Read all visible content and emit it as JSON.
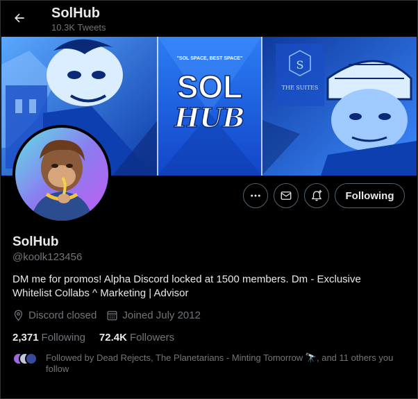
{
  "header": {
    "title": "SolHub",
    "tweets_count": "10.3K Tweets"
  },
  "banner": {
    "tagline": "\"SOL SPACE, BEST SPACE\"",
    "logo_line1": "SOL",
    "logo_line2": "HUB",
    "suites_monogram": "S",
    "suites_label": "THE SUITES"
  },
  "actions": {
    "follow_label": "Following"
  },
  "profile": {
    "name": "SolHub",
    "handle": "@koolk123456",
    "bio": "DM me for promos! Alpha Discord locked at 1500 members. Dm - Exclusive Whitelist Collabs ^ Marketing | Advisor",
    "location": "Discord closed",
    "joined": "Joined July 2012",
    "following_count": "2,371",
    "following_label": "Following",
    "followers_count": "72.4K",
    "followers_label": "Followers",
    "followed_by": "Followed by Dead Rejects, The Planetarians - Minting Tomorrow 🔭, and 11 others you follow"
  },
  "colors": {
    "background": "#000000",
    "text_primary": "#e7e9ea",
    "text_secondary": "#71767b",
    "border": "#536471",
    "banner_blue": "#1e5fd8"
  }
}
